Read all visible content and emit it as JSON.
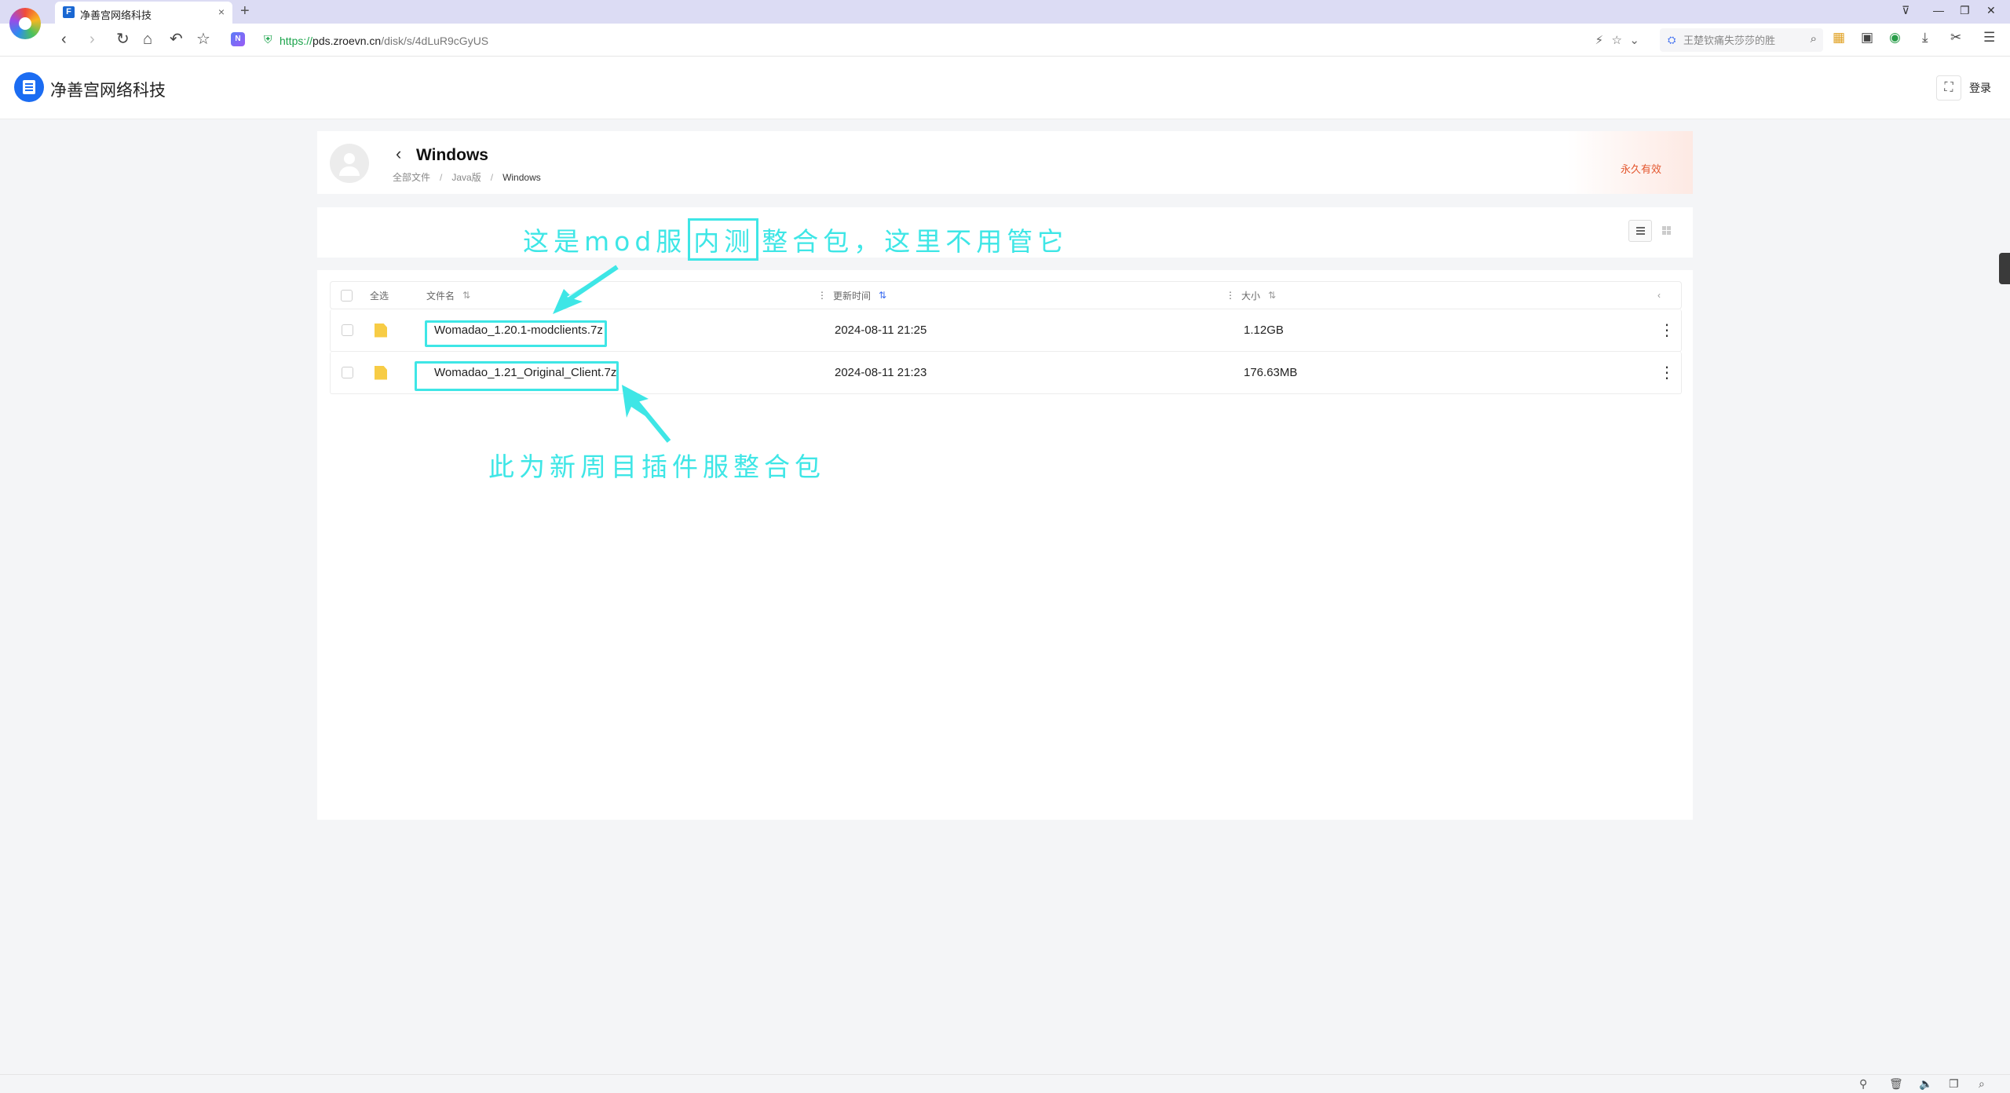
{
  "browser": {
    "tab_title": "净善宫网络科技",
    "tab_favicon": "F",
    "tab_close": "×",
    "new_tab": "+",
    "url_proto": "https://",
    "url_host": "pds.zroevn.cn",
    "url_path": "/disk/s/4dLuR9cGyUS",
    "search_placeholder": "王楚钦痛失莎莎的胜",
    "icons": {
      "back": "‹",
      "forward": "›",
      "reload": "↻",
      "home": "⌂",
      "undo": "↶",
      "star": "☆",
      "ext": "N",
      "shield": "⛨",
      "bolt": "⚡",
      "fav": "☆",
      "chevron": "⌄",
      "search_engine": "⛭",
      "search": "⌕",
      "apps": "▦",
      "window": "▣",
      "globe": "◉",
      "download": "⤓",
      "cut": "✂",
      "menu": "☰",
      "skin": "⊽",
      "minimize": "—",
      "restore": "❐",
      "close": "✕"
    }
  },
  "site": {
    "name": "净善宫网络科技",
    "qr_icon": "⛶",
    "login_label": "登录"
  },
  "folder": {
    "back_icon": "‹",
    "title": "Windows",
    "breadcrumb": [
      "全部文件",
      "Java版",
      "Windows"
    ],
    "breadcrumb_sep": "/",
    "validity": "永久有效"
  },
  "table": {
    "select_all": "全选",
    "columns": {
      "name": "文件名",
      "time": "更新时间",
      "size": "大小"
    },
    "sort_icon": "⇅",
    "col_menu_icon": "⋮",
    "collapse_icon": "‹",
    "more_icon": "⋮",
    "rows": [
      {
        "name": "Womadao_1.20.1-modclients.7z",
        "time": "2024-08-11 21:25",
        "size": "1.12GB"
      },
      {
        "name": "Womadao_1.21_Original_Client.7z",
        "time": "2024-08-11 21:23",
        "size": "176.63MB"
      }
    ]
  },
  "annotations": {
    "top_note_before": "这是mod服",
    "top_note_boxed": "内测",
    "top_note_after": "整合包，这里不用管它",
    "bottom_note": "此为新周目插件服整合包",
    "color": "#3ee6e6"
  },
  "statusbar_icons": [
    "⚲",
    "🗑",
    "🔈",
    "❐",
    "⌕"
  ]
}
